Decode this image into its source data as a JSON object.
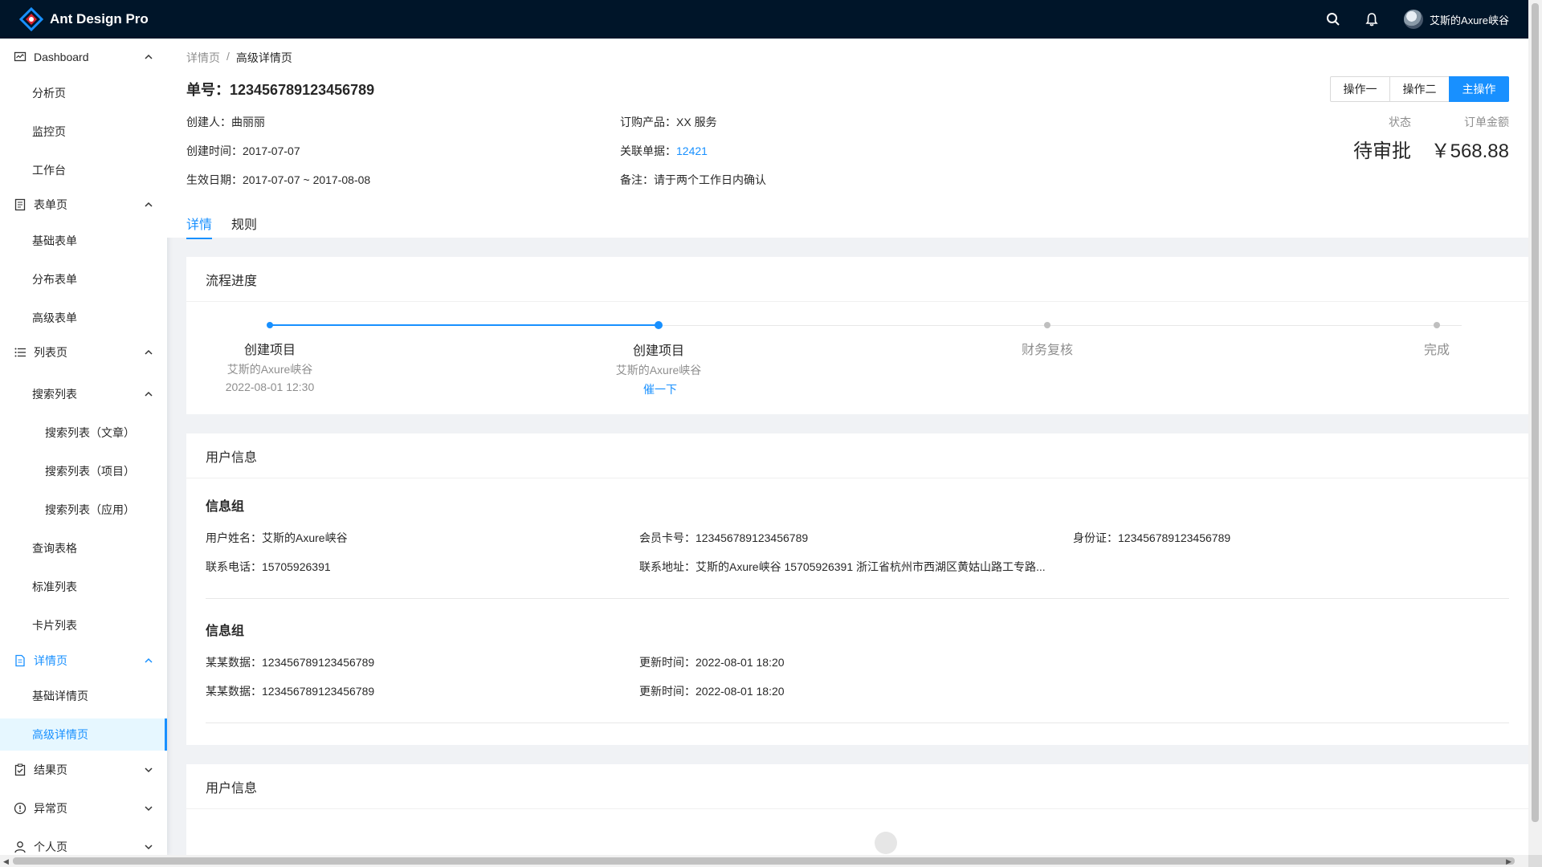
{
  "header": {
    "app_title": "Ant Design Pro",
    "user_name": "艾斯的Axure峡谷"
  },
  "sidebar": {
    "items": [
      {
        "label": "Dashboard"
      },
      {
        "label": "分析页"
      },
      {
        "label": "监控页"
      },
      {
        "label": "工作台"
      },
      {
        "label": "表单页"
      },
      {
        "label": "基础表单"
      },
      {
        "label": "分布表单"
      },
      {
        "label": "高级表单"
      },
      {
        "label": "列表页"
      },
      {
        "label": "搜索列表"
      },
      {
        "label": "搜索列表（文章）"
      },
      {
        "label": "搜索列表（项目）"
      },
      {
        "label": "搜索列表（应用）"
      },
      {
        "label": "查询表格"
      },
      {
        "label": "标准列表"
      },
      {
        "label": "卡片列表"
      },
      {
        "label": "详情页"
      },
      {
        "label": "基础详情页"
      },
      {
        "label": "高级详情页"
      },
      {
        "label": "结果页"
      },
      {
        "label": "异常页"
      },
      {
        "label": "个人页"
      }
    ]
  },
  "breadcrumb": {
    "parent": "详情页",
    "sep": "/",
    "current": "高级详情页"
  },
  "page": {
    "title": "单号：123456789123456789",
    "creator": "创建人：曲丽丽",
    "product": "订购产品：XX 服务",
    "created": "创建时间：2017-07-07",
    "related_label": "关联单据：",
    "related_value": "12421",
    "effective": "生效日期：2017-07-07 ~ 2017-08-08",
    "remark": "备注：请于两个工作日内确认"
  },
  "actions": {
    "op1": "操作一",
    "op2": "操作二",
    "main": "主操作"
  },
  "stats": {
    "status_label": "状态",
    "status_value": "待审批",
    "amount_label": "订单金额",
    "amount_value": "￥568.88"
  },
  "tabs": {
    "detail": "详情",
    "rules": "规则"
  },
  "progress": {
    "title": "流程进度",
    "steps": [
      {
        "title": "创建项目",
        "sub1": "艾斯的Axure峡谷",
        "sub2": "2022-08-01  12:30"
      },
      {
        "title": "创建项目",
        "sub1": "艾斯的Axure峡谷",
        "link": "催一下"
      },
      {
        "title": "财务复核"
      },
      {
        "title": "完成"
      }
    ]
  },
  "user_info": {
    "title": "用户信息",
    "group1_title": "信息组",
    "name": "用户姓名：艾斯的Axure峡谷",
    "card": "会员卡号：123456789123456789",
    "idcard": "身份证：123456789123456789",
    "phone": "联系电话：15705926391",
    "address": "联系地址：艾斯的Axure峡谷  15705926391 浙江省杭州市西湖区黄姑山路工专路...",
    "group2_title": "信息组",
    "data1": "某某数据：123456789123456789",
    "time1": "更新时间：2022-08-01  18:20",
    "data2": "某某数据：123456789123456789",
    "time2": "更新时间：2022-08-01  18:20"
  },
  "user_info2": {
    "title": "用户信息"
  },
  "colors": {
    "primary": "#1890ff",
    "header_bg": "#001529",
    "page_bg": "#f0f2f5"
  }
}
